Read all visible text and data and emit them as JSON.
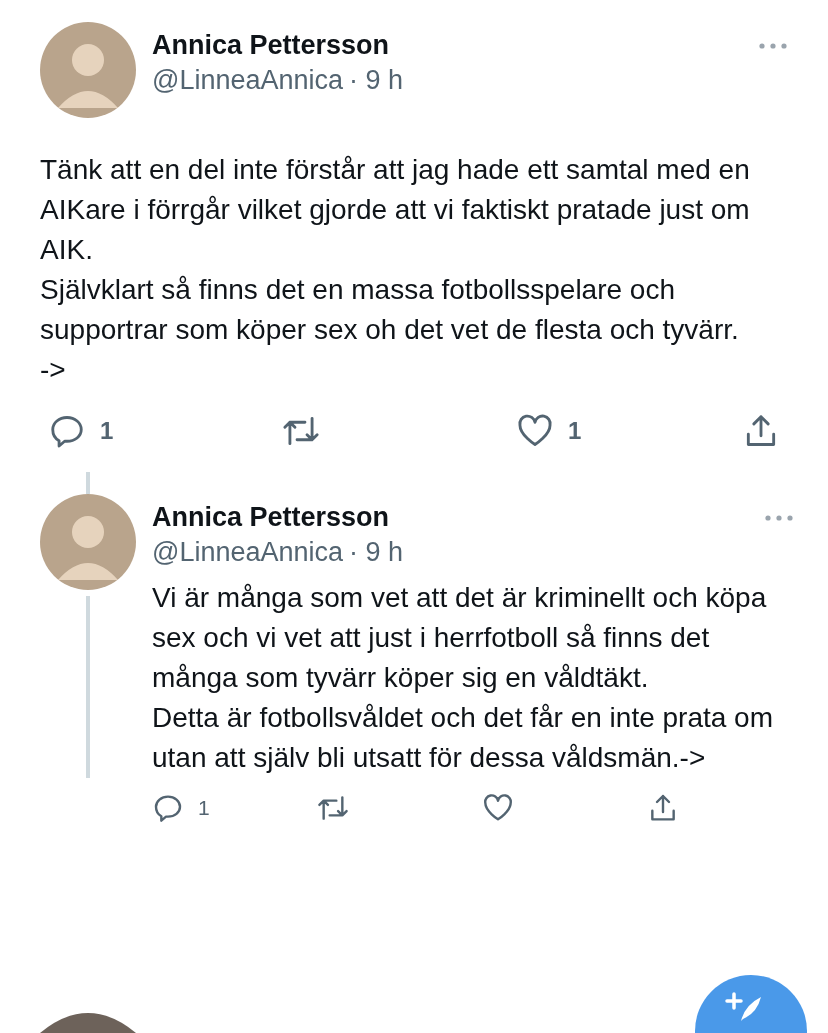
{
  "tweets": [
    {
      "name": "Annica Pettersson",
      "handle": "@LinneaAnnica",
      "time": "· 9 h",
      "kind": "main",
      "paragraphs": [
        "Tänk att en del inte förstår att jag hade ett samtal med en AIKare i förrgår vilket gjorde att vi faktiskt pratade just om AIK.",
        "Självklart så finns det en massa fotbollsspelare och supportrar som köper sex oh det vet de flesta och tyvärr.",
        "->"
      ],
      "actions": [
        {
          "kind": "reply",
          "count": "1"
        },
        {
          "kind": "retweet"
        },
        {
          "kind": "like",
          "count": "1"
        },
        {
          "kind": "share"
        }
      ]
    },
    {
      "name": "Annica Pettersson",
      "handle": "@LinneaAnnica",
      "time": "· 9 h",
      "kind": "thread",
      "paragraphs": [
        "Vi är många som vet att det är kriminellt och köpa sex och vi vet att just i herrfotboll så finns det många som tyvärr köper sig en våldtäkt.",
        "Detta är fotbollsvåldet och det får en inte prata om utan att själv bli utsatt för dessa våldsmän.->"
      ],
      "actions": [
        {
          "kind": "reply",
          "count": "1"
        },
        {
          "kind": "retweet"
        },
        {
          "kind": "like"
        },
        {
          "kind": "share"
        }
      ]
    }
  ]
}
